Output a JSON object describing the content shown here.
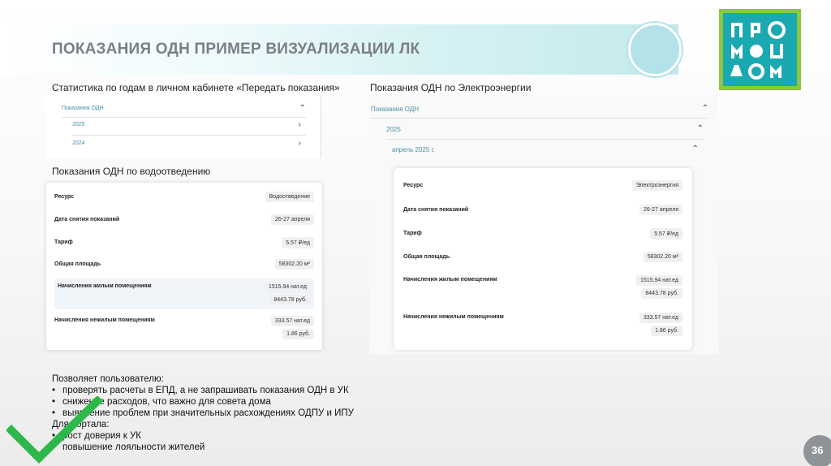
{
  "slide": {
    "title": "ПОКАЗАНИЯ ОДН ПРИМЕР ВИЗУАЛИЗАЦИИ ЛК",
    "page_number": "36"
  },
  "logo": {
    "brand_text": "ПРО МОЙ ДОМ",
    "colors": {
      "frame": "#8dc63f",
      "fill": "#1aa9b1"
    }
  },
  "captions": {
    "stats": "Статистика по годам в личном кабинете «Передать показания»",
    "water": "Показания ОДН по водоотведению",
    "electric": "Показания ОДН по Электроэнергии"
  },
  "stats_widget": {
    "header": "Показания ОДН",
    "years": [
      "2025",
      "2024"
    ]
  },
  "water_card": {
    "rows": [
      {
        "key": "Ресурс",
        "value": "Водоотведение"
      },
      {
        "key": "Дата снятия показаний",
        "value": "26-27 апреля"
      },
      {
        "key": "Тариф",
        "value": "5.57 ₽/ед"
      },
      {
        "key": "Общая площадь",
        "value": "58302.20 м²"
      }
    ],
    "living": {
      "key": "Начисления жилым помещениям",
      "units": "1515.94 нат.ед",
      "rub": "8443.78 руб."
    },
    "nonliving": {
      "key": "Начисления нежилым помещениям",
      "units": "333.57 нат.ед",
      "rub": "1.86 руб."
    }
  },
  "electric_widget": {
    "header": "Показания ОДН",
    "year": "2025",
    "month": "апрель 2025 г.",
    "rows": [
      {
        "key": "Ресурс",
        "value": "Электроэнергия"
      },
      {
        "key": "Дата снятия показаний",
        "value": "26-27 апреля"
      },
      {
        "key": "Тариф",
        "value": "5.57 ₽/ед"
      },
      {
        "key": "Общая площадь",
        "value": "58302.20 м²"
      }
    ],
    "living": {
      "key": "Начисления жилым помещениям",
      "units": "1515.94 нат.ед",
      "rub": "8443.78 руб."
    },
    "nonliving": {
      "key": "Начисления нежилым помещениям",
      "units": "333.57 нат.ед",
      "rub": "1.86 руб."
    }
  },
  "benefits": {
    "intro": "Позволяет пользователю:",
    "user_items": [
      "проверять расчеты в ЕПД, а не запрашивать показания ОДН в УК",
      "снижение расходов, что важно для совета дома",
      "выявление проблем при значительных расхождениях ОДПУ и ИПУ"
    ],
    "portal_intro": "Для портала:",
    "portal_items": [
      "рост доверия к УК",
      "повышение лояльности жителей"
    ]
  },
  "colors": {
    "accent": "#1aa9b1",
    "check": "#2eb84b",
    "banner": "#c4e9ed"
  },
  "icons": {
    "check": "checkmark-icon",
    "chevron": "chevron-icon"
  }
}
